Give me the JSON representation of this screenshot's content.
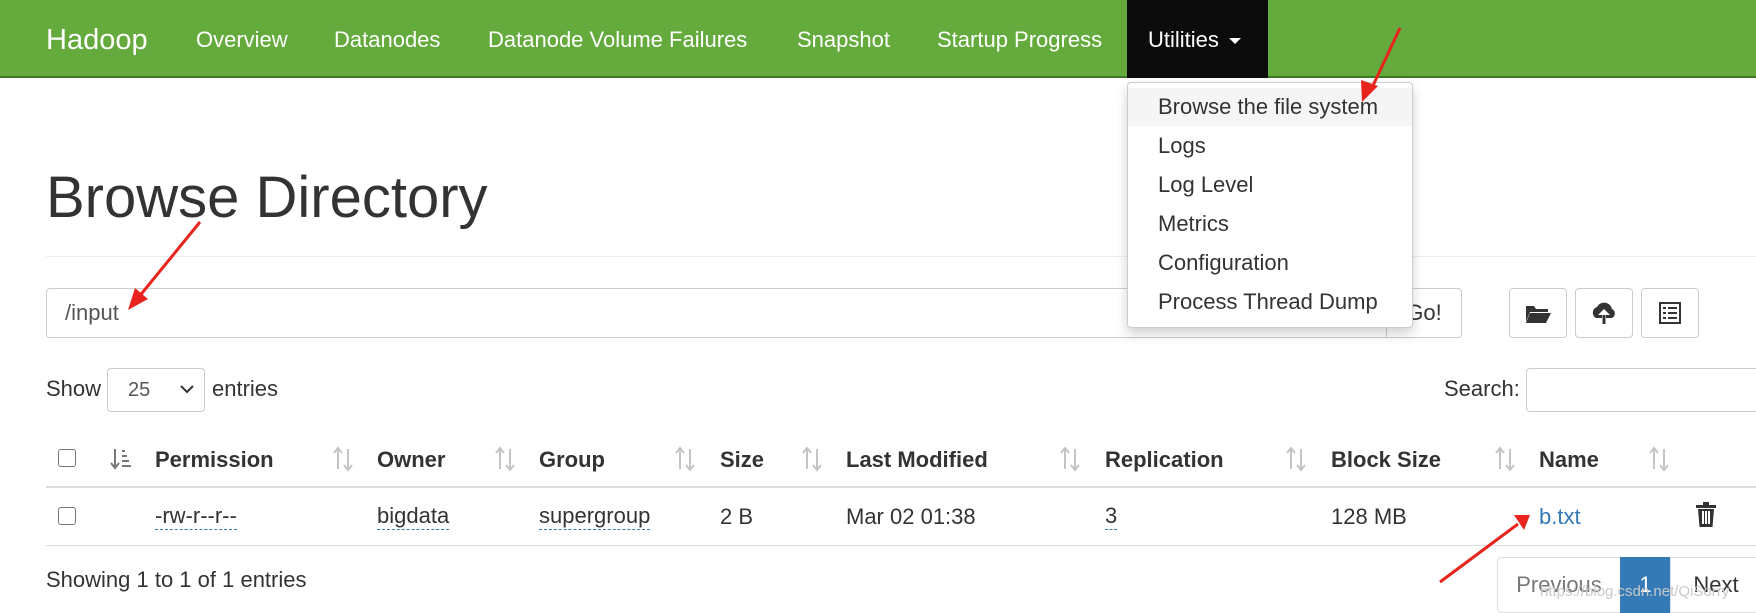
{
  "navbar": {
    "brand": "Hadoop",
    "links": [
      {
        "label": "Overview"
      },
      {
        "label": "Datanodes"
      },
      {
        "label": "Datanode Volume Failures"
      },
      {
        "label": "Snapshot"
      },
      {
        "label": "Startup Progress"
      }
    ],
    "utilities": "Utilities",
    "bar_color": "#64aa3c",
    "active_color": "#0b0b0b"
  },
  "utilities_menu": {
    "items": [
      {
        "label": "Browse the file system"
      },
      {
        "label": "Logs"
      },
      {
        "label": "Log Level"
      },
      {
        "label": "Metrics"
      },
      {
        "label": "Configuration"
      },
      {
        "label": "Process Thread Dump"
      }
    ],
    "highlighted": "Browse the file system"
  },
  "page": {
    "title": "Browse Directory"
  },
  "path_bar": {
    "value": "/input",
    "go_label": "Go!",
    "icons": [
      "folder-open-icon",
      "cloud-upload-icon",
      "list-icon"
    ]
  },
  "table_controls": {
    "show_label": "Show",
    "length_value": "25",
    "entries_label": "entries",
    "search_label": "Search:",
    "search_value": ""
  },
  "table": {
    "columns": [
      "Permission",
      "Owner",
      "Group",
      "Size",
      "Last Modified",
      "Replication",
      "Block Size",
      "Name"
    ],
    "rows": [
      {
        "permission": "-rw-r--r--",
        "owner": "bigdata",
        "group": "supergroup",
        "size": "2 B",
        "last_modified": "Mar 02 01:38",
        "replication": "3",
        "block_size": "128 MB",
        "name": "b.txt"
      }
    ],
    "link_color": "#337ab7"
  },
  "footer": {
    "info": "Showing 1 to 1 of 1 entries",
    "previous": "Previous",
    "current_page": "1",
    "next": "Next"
  },
  "watermark": "https://blog.csdn.net/QiSorry",
  "annotation": {
    "arrow_color": "#e8241c"
  }
}
